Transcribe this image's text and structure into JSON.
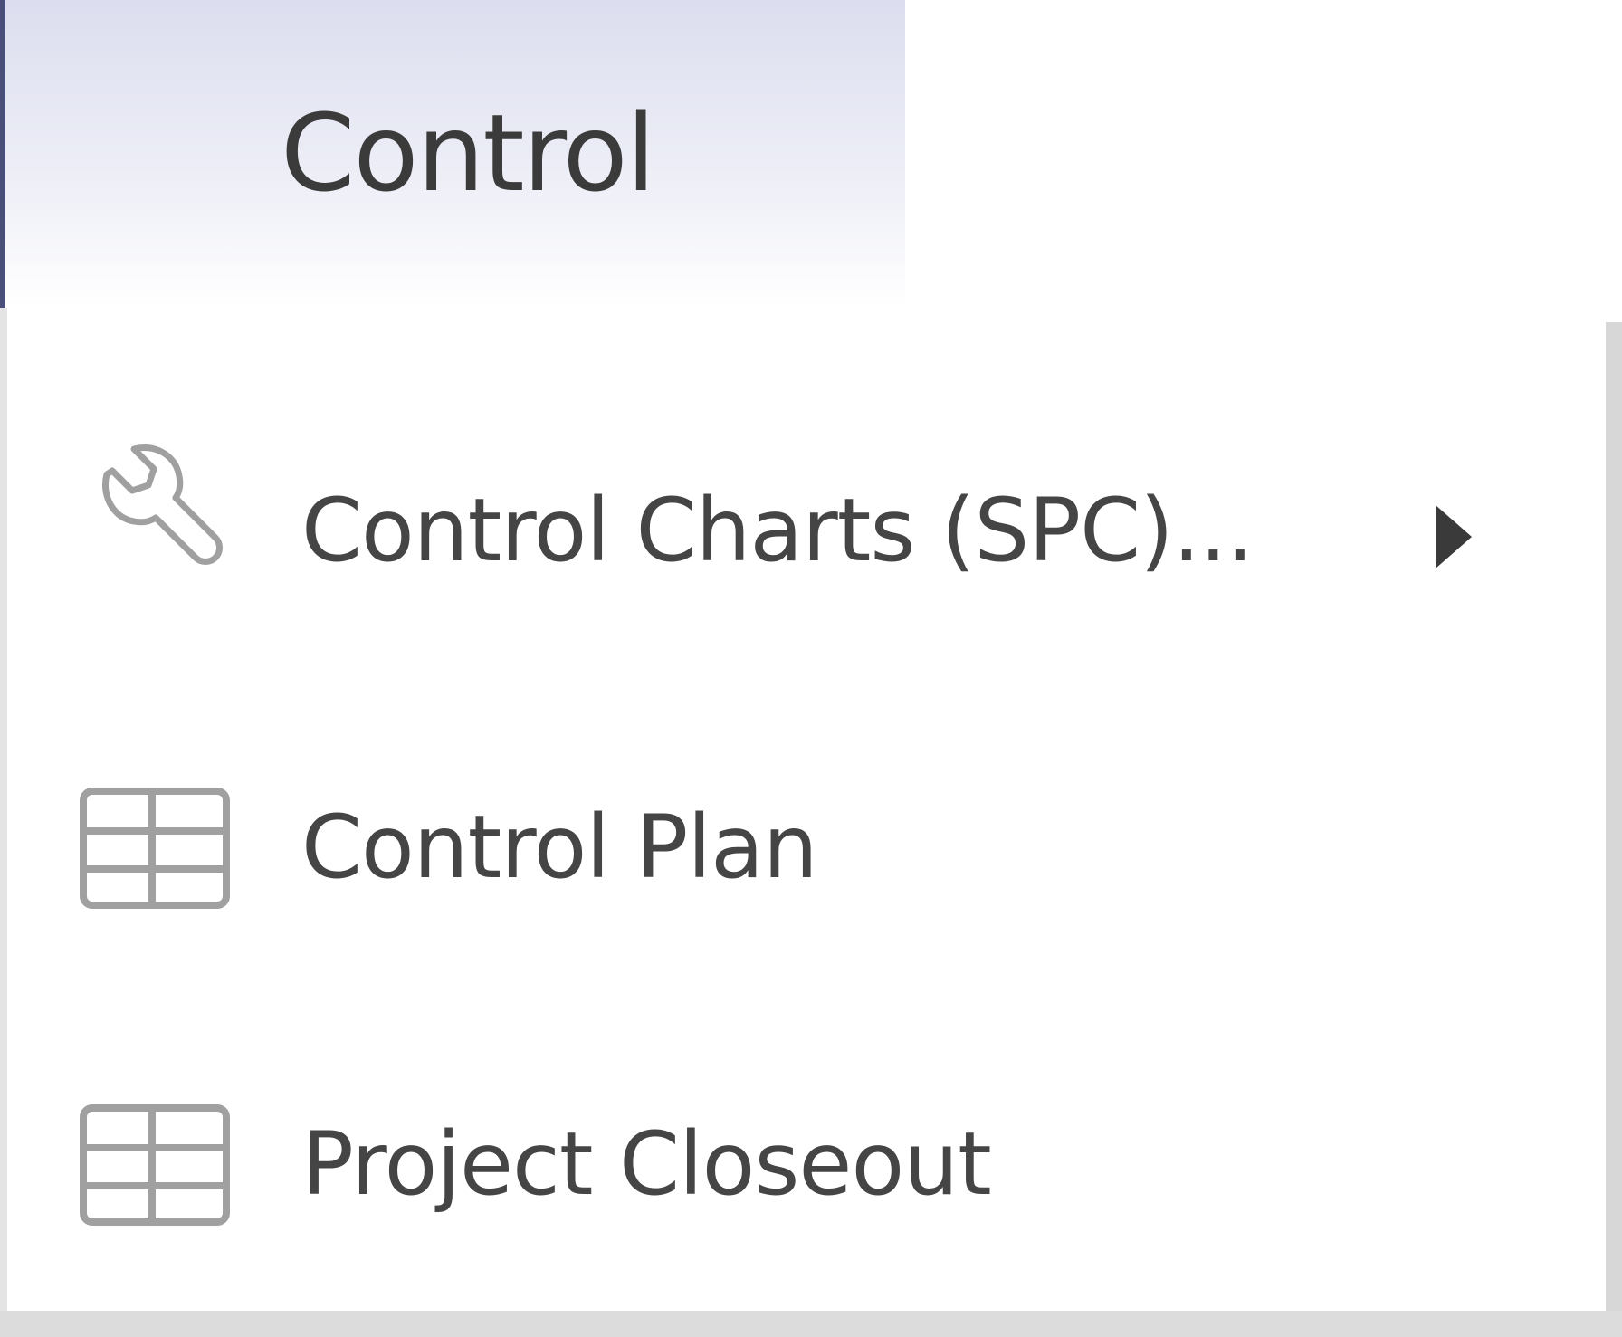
{
  "tab": {
    "title": "Control"
  },
  "menu": {
    "items": [
      {
        "label": "Control Charts (SPC)...",
        "icon": "wrench-icon",
        "has_submenu": true
      },
      {
        "label": "Control Plan",
        "icon": "table-grid-icon",
        "has_submenu": false
      },
      {
        "label": "Project Closeout",
        "icon": "table-grid-icon",
        "has_submenu": false
      }
    ]
  },
  "colors": {
    "text": "#454545",
    "tab_gradient_top": "#dcdeef",
    "icon_stroke": "#9a9a9a"
  }
}
